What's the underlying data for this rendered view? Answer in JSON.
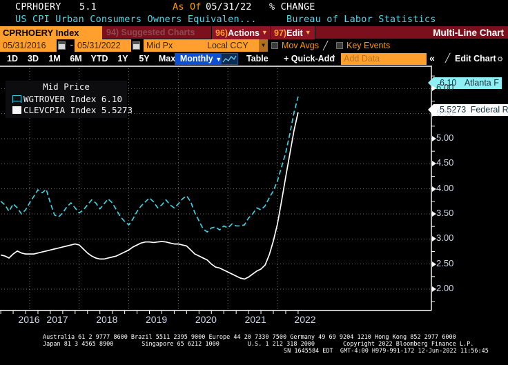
{
  "header": {
    "ticker": "CPRHOERY",
    "last_value": "5.1",
    "as_of_label": "As Of",
    "as_of_date": "05/31/22",
    "pct_change_label": "% CHANGE",
    "description": "US CPI Urban Consumers Owners Equivalen...",
    "source": "Bureau of Labor Statistics"
  },
  "toolbar": {
    "ticker_field": "CPRHOERY Index",
    "suggested_charts": "94) Suggested Charts",
    "actions_num": "96)",
    "actions_label": "Actions",
    "edit_num": "97)",
    "edit_label": "Edit",
    "chart_type": "Multi-Line Chart"
  },
  "controls": {
    "start_date": "05/31/2016",
    "date_sep": "-",
    "end_date": "05/31/2022",
    "price_type": "Mid Px",
    "currency": "Local CCY",
    "mov_avgs_label": "Mov Avgs",
    "key_events_label": "Key Events"
  },
  "periods": {
    "buttons": [
      "1D",
      "3D",
      "1M",
      "6M",
      "YTD",
      "1Y",
      "5Y",
      "Max"
    ],
    "selected_frequency": "Monthly",
    "graph_icon": "line-chart-icon",
    "table_label": "Table",
    "quick_add_label": "+ Quick-Add",
    "add_data_placeholder": "Add Data",
    "collapse_label": "«",
    "edit_chart_label": "Edit Chart",
    "gear_icon": "gear-icon"
  },
  "legend": {
    "title": "Mid Price",
    "rows": [
      {
        "name": "WGTROVER Index",
        "value": "6.10",
        "color": "#3fd0e0",
        "style": "dashed"
      },
      {
        "name": "CLEVCPIA Index",
        "value": "5.5273",
        "color": "#ffffff",
        "style": "solid"
      }
    ]
  },
  "callouts": [
    {
      "value": "6.10",
      "label": "Atlanta F",
      "bg": "#8ef0f5",
      "y": 113
    },
    {
      "value": "5.5273",
      "label": "Federal R",
      "bg": "#ffffff",
      "y": 152
    }
  ],
  "chart_data": {
    "type": "line",
    "title": "Mid Price",
    "xlabel": "",
    "ylabel": "",
    "grid": true,
    "legend_position": "top-left",
    "ylim": [
      1.75,
      6.25
    ],
    "yticks": [
      2.0,
      2.5,
      3.0,
      3.5,
      4.0,
      4.5,
      5.0,
      5.5,
      6.0
    ],
    "ytick_labels": [
      "2.00",
      "2.50",
      "3.00",
      "3.50",
      "4.00",
      "4.50",
      "5.00",
      "5.50",
      "6.00"
    ],
    "y_axis_side": "right",
    "xtick_labels": [
      "2016",
      "2017",
      "2018",
      "2019",
      "2020",
      "2021",
      "2022"
    ],
    "xlim": [
      "2016-05-31",
      "2022-05-31"
    ],
    "x": [
      "2016-05",
      "2016-06",
      "2016-07",
      "2016-08",
      "2016-09",
      "2016-10",
      "2016-11",
      "2016-12",
      "2017-01",
      "2017-02",
      "2017-03",
      "2017-04",
      "2017-05",
      "2017-06",
      "2017-07",
      "2017-08",
      "2017-09",
      "2017-10",
      "2017-11",
      "2017-12",
      "2018-01",
      "2018-02",
      "2018-03",
      "2018-04",
      "2018-05",
      "2018-06",
      "2018-07",
      "2018-08",
      "2018-09",
      "2018-10",
      "2018-11",
      "2018-12",
      "2019-01",
      "2019-02",
      "2019-03",
      "2019-04",
      "2019-05",
      "2019-06",
      "2019-07",
      "2019-08",
      "2019-09",
      "2019-10",
      "2019-11",
      "2019-12",
      "2020-01",
      "2020-02",
      "2020-03",
      "2020-04",
      "2020-05",
      "2020-06",
      "2020-07",
      "2020-08",
      "2020-09",
      "2020-10",
      "2020-11",
      "2020-12",
      "2021-01",
      "2021-02",
      "2021-03",
      "2021-04",
      "2021-05",
      "2021-06",
      "2021-07",
      "2021-08",
      "2021-09",
      "2021-10",
      "2021-11",
      "2021-12",
      "2022-01",
      "2022-02",
      "2022-03",
      "2022-04",
      "2022-05"
    ],
    "series": [
      {
        "name": "WGTROVER Index",
        "display_name": "Atlanta F",
        "color": "#3fd0e0",
        "style": "dashed",
        "last_value": 6.1,
        "values": [
          3.75,
          3.68,
          3.55,
          3.7,
          3.62,
          3.5,
          3.58,
          3.72,
          3.85,
          3.98,
          3.92,
          3.99,
          3.72,
          3.48,
          3.44,
          3.52,
          3.64,
          3.72,
          3.62,
          3.52,
          3.58,
          3.68,
          3.78,
          3.72,
          3.6,
          3.7,
          3.8,
          3.72,
          3.58,
          3.44,
          3.35,
          3.28,
          3.4,
          3.55,
          3.66,
          3.74,
          3.82,
          3.74,
          3.62,
          3.68,
          3.78,
          3.68,
          3.62,
          3.7,
          3.8,
          3.86,
          3.74,
          3.52,
          3.36,
          3.2,
          3.14,
          3.22,
          3.24,
          3.18,
          3.26,
          3.22,
          3.3,
          3.26,
          3.26,
          3.28,
          3.42,
          3.5,
          3.62,
          3.58,
          3.66,
          3.82,
          3.96,
          4.16,
          4.44,
          4.72,
          5.1,
          5.52,
          5.84
        ]
      },
      {
        "name": "CLEVCPIA Index",
        "display_name": "Federal R",
        "color": "#ffffff",
        "style": "solid",
        "last_value": 5.5273,
        "values": [
          2.68,
          2.66,
          2.62,
          2.7,
          2.76,
          2.72,
          2.7,
          2.7,
          2.7,
          2.72,
          2.74,
          2.76,
          2.78,
          2.8,
          2.82,
          2.84,
          2.86,
          2.88,
          2.9,
          2.88,
          2.8,
          2.72,
          2.66,
          2.62,
          2.6,
          2.6,
          2.62,
          2.64,
          2.66,
          2.7,
          2.74,
          2.78,
          2.84,
          2.88,
          2.92,
          2.94,
          2.94,
          2.93,
          2.94,
          2.95,
          2.94,
          2.92,
          2.9,
          2.9,
          2.88,
          2.86,
          2.78,
          2.7,
          2.66,
          2.62,
          2.58,
          2.5,
          2.44,
          2.42,
          2.38,
          2.34,
          2.3,
          2.26,
          2.22,
          2.2,
          2.24,
          2.3,
          2.36,
          2.4,
          2.48,
          2.68,
          2.96,
          3.3,
          3.76,
          4.24,
          4.7,
          5.16,
          5.5273
        ]
      }
    ]
  },
  "footer": {
    "line1": "Australia 61 2 9777 8600 Brazil 5511 2395 9000 Europe 44 20 7330 7500 Germany 49 69 9204 1210 Hong Kong 852 2977 6000",
    "line2": "Japan 81 3 4565 8900        Singapore 65 6212 1000        U.S. 1 212 318 2000        Copyright 2022 Bloomberg Finance L.P.",
    "line3": "SN 1645584 EDT  GMT-4:00 H979-991-172 12-Jun-2022 11:56:45"
  }
}
